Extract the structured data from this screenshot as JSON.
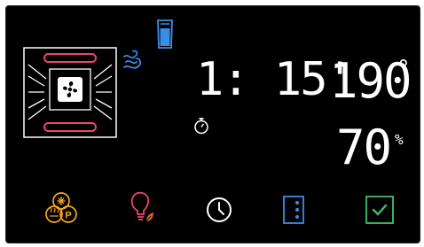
{
  "display": {
    "time": "1: 15'",
    "temperature": "190",
    "temperature_unit": "°",
    "humidity": "70",
    "humidity_unit": "%"
  },
  "colors": {
    "background": "#000000",
    "heating_element": "#e8476a",
    "fan_panel": "#ffffff",
    "steam_blue": "#3a8ee8",
    "orange": "#f5a623",
    "eco_red": "#e8476a",
    "eco_green": "#d9641d",
    "settings_blue": "#3a8ee8",
    "confirm_green": "#3cc46a"
  },
  "icons": {
    "oven_mode": "hot-air-fan-icon",
    "steam": "steam-icon",
    "water_tank": "water-tank-icon",
    "timer": "stopwatch-icon",
    "programs": "programs-icon",
    "eco": "eco-light-icon",
    "clock": "clock-icon",
    "settings": "settings-menu-icon",
    "confirm": "confirm-check-icon"
  }
}
